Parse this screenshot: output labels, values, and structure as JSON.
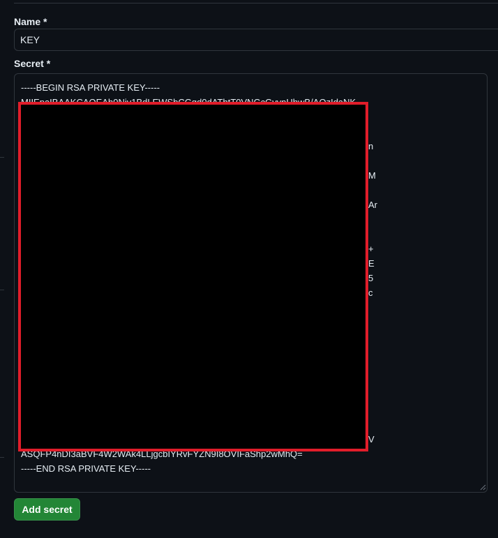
{
  "form": {
    "name_label": "Name *",
    "name_value": "KEY",
    "secret_label": "Secret *",
    "secret": {
      "line_first": "-----BEGIN RSA PRIVATE KEY-----",
      "line_second_partial": "MIIEpaIBAAKCAQEAh0Njv1BdLEWSbCGqd0dAThtT0VNGcGvvnUhwB/AOzIdaNK",
      "line_second_last_partial": "ASQFP4nDI3aBVF4W2WAk4LLjgcbIYRvFYZN9I8OVIFaShp2wMhQ=",
      "line_last": "-----END RSA PRIVATE KEY-----",
      "edge_fragments": [
        "n",
        "M",
        "Ar",
        "+",
        "E",
        "5",
        "c",
        "V"
      ]
    },
    "submit_label": "Add secret"
  },
  "colors": {
    "background": "#0d1117",
    "border": "#30363d",
    "text": "#e6edf3",
    "button": "#238636",
    "redaction_border": "#e11d2a"
  }
}
